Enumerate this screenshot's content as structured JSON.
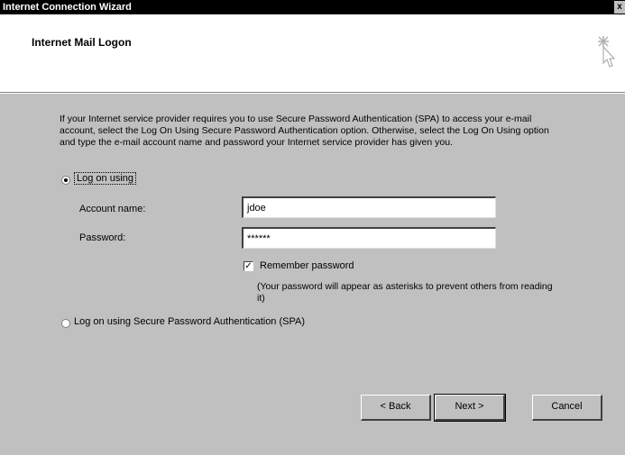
{
  "window": {
    "title": "Internet Connection Wizard",
    "close_glyph": "x"
  },
  "header": {
    "title": "Internet Mail Logon"
  },
  "intro_text": "If your Internet service provider requires you to use Secure Password Authentication (SPA) to access your e-mail account, select the Log On Using Secure Password Authentication option. Otherwise, select the Log On Using option and type the e-mail account name and password your Internet service provider has given you.",
  "logon_option": {
    "label": "Log on using",
    "selected": true
  },
  "account": {
    "label": "Account name:",
    "value": "jdoe"
  },
  "password": {
    "label": "Password:",
    "value": "******"
  },
  "remember": {
    "label": "Remember password",
    "checked": true,
    "check_glyph": "✓"
  },
  "password_note": "(Your password will appear as asterisks to prevent others from reading it)",
  "spa_option": {
    "label": "Log on using Secure Password Authentication (SPA)",
    "selected": false
  },
  "buttons": {
    "back": "< Back",
    "next": "Next >",
    "cancel": "Cancel"
  }
}
